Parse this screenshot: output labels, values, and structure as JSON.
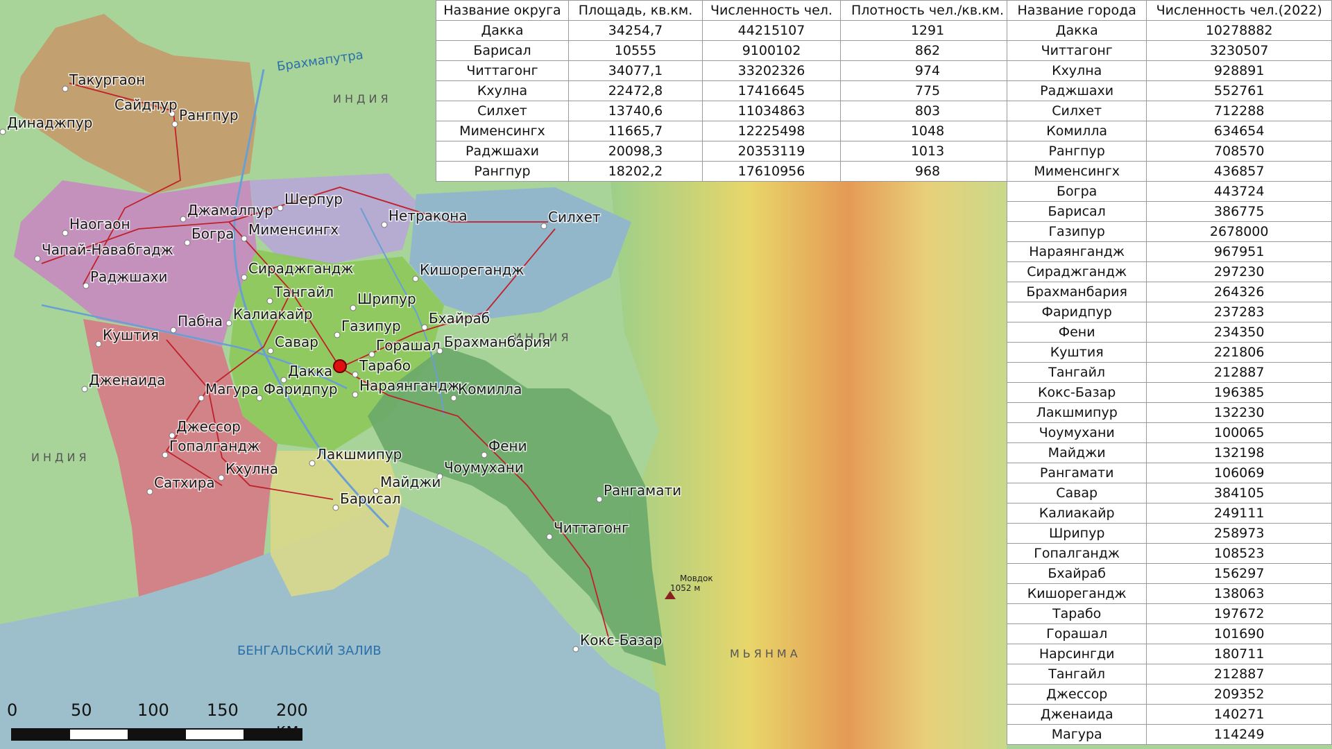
{
  "map": {
    "country_labels": [
      "ИНДИЯ",
      "ИНДИЯ",
      "ИНДИЯ",
      "МЬЯНМА"
    ],
    "water_labels": {
      "bay": "БЕНГАЛЬСКИЙ ЗАЛИВ",
      "river": "Брахмапутра"
    },
    "peak": {
      "name": "Мовдок",
      "height": "1052 м"
    },
    "cities": [
      "Такургаон",
      "Сайдпур",
      "Рангпур",
      "Динаджпур",
      "Джамалпур",
      "Шерпур",
      "Наогаон",
      "Богра",
      "Мименсингх",
      "Нетракона",
      "Силхет",
      "Чапай-Навабгадж",
      "Раджшахи",
      "Сираджгандж",
      "Кишорегандж",
      "Тангайл",
      "Шрипур",
      "Калиакайр",
      "Бхайраб",
      "Газипур",
      "Пабна",
      "Куштия",
      "Савар",
      "Горашал",
      "Брахманбария",
      "Дакка",
      "Тарабо",
      "Дженаида",
      "Магура",
      "Фаридпур",
      "Нараянгандж",
      "Комилла",
      "Джессор",
      "Гопалгандж",
      "Фени",
      "Лакшмипур",
      "Чоумухани",
      "Кхулна",
      "Сатхира",
      "Майджи",
      "Барисал",
      "Рангамати",
      "Читтагонг",
      "Кокс-Базар"
    ]
  },
  "district_table": {
    "headers": [
      "Название округа",
      "Площадь, кв.км.",
      "Численность чел.",
      "Плотность чел./кв.км."
    ],
    "rows": [
      [
        "Дакка",
        "34254,7",
        "44215107",
        "1291"
      ],
      [
        "Барисал",
        "10555",
        "9100102",
        "862"
      ],
      [
        "Читтагонг",
        "34077,1",
        "33202326",
        "974"
      ],
      [
        "Кхулна",
        "22472,8",
        "17416645",
        "775"
      ],
      [
        "Силхет",
        "13740,6",
        "11034863",
        "803"
      ],
      [
        "Мименсингх",
        "11665,7",
        "12225498",
        "1048"
      ],
      [
        "Раджшахи",
        "20098,3",
        "20353119",
        "1013"
      ],
      [
        "Рангпур",
        "18202,2",
        "17610956",
        "968"
      ]
    ]
  },
  "city_table": {
    "headers": [
      "Название города",
      "Численность чел.(2022)"
    ],
    "rows": [
      [
        "Дакка",
        "10278882"
      ],
      [
        "Читтагонг",
        "3230507"
      ],
      [
        "Кхулна",
        "928891"
      ],
      [
        "Раджшахи",
        "552761"
      ],
      [
        "Силхет",
        "712288"
      ],
      [
        "Комилла",
        "634654"
      ],
      [
        "Рангпур",
        "708570"
      ],
      [
        "Мименсингх",
        "436857"
      ],
      [
        "Богра",
        "443724"
      ],
      [
        "Барисал",
        "386775"
      ],
      [
        "Газипур",
        "2678000"
      ],
      [
        "Нараянгандж",
        "967951"
      ],
      [
        "Сираджгандж",
        "297230"
      ],
      [
        "Брахманбария",
        "264326"
      ],
      [
        "Фаридпур",
        "237283"
      ],
      [
        "Фени",
        "234350"
      ],
      [
        "Куштия",
        "221806"
      ],
      [
        "Тангайл",
        "212887"
      ],
      [
        "Кокс-Базар",
        "196385"
      ],
      [
        "Лакшмипур",
        "132230"
      ],
      [
        "Чоумухани",
        "100065"
      ],
      [
        "Майджи",
        "132198"
      ],
      [
        "Рангамати",
        "106069"
      ],
      [
        "Савар",
        "384105"
      ],
      [
        "Калиакайр",
        "249111"
      ],
      [
        "Шрипур",
        "258973"
      ],
      [
        "Гопалгандж",
        "108523"
      ],
      [
        "Бхайраб",
        "156297"
      ],
      [
        "Кишорегандж",
        "138063"
      ],
      [
        "Тарабо",
        "197672"
      ],
      [
        "Горашал",
        "101690"
      ],
      [
        "Нарсингди",
        "180711"
      ],
      [
        "Тангайл",
        "212887"
      ],
      [
        "Джессор",
        "209352"
      ],
      [
        "Дженаида",
        "140271"
      ],
      [
        "Магура",
        "114249"
      ]
    ]
  },
  "scale": {
    "ticks": [
      "0",
      "50",
      "100",
      "150",
      "200 км"
    ]
  }
}
